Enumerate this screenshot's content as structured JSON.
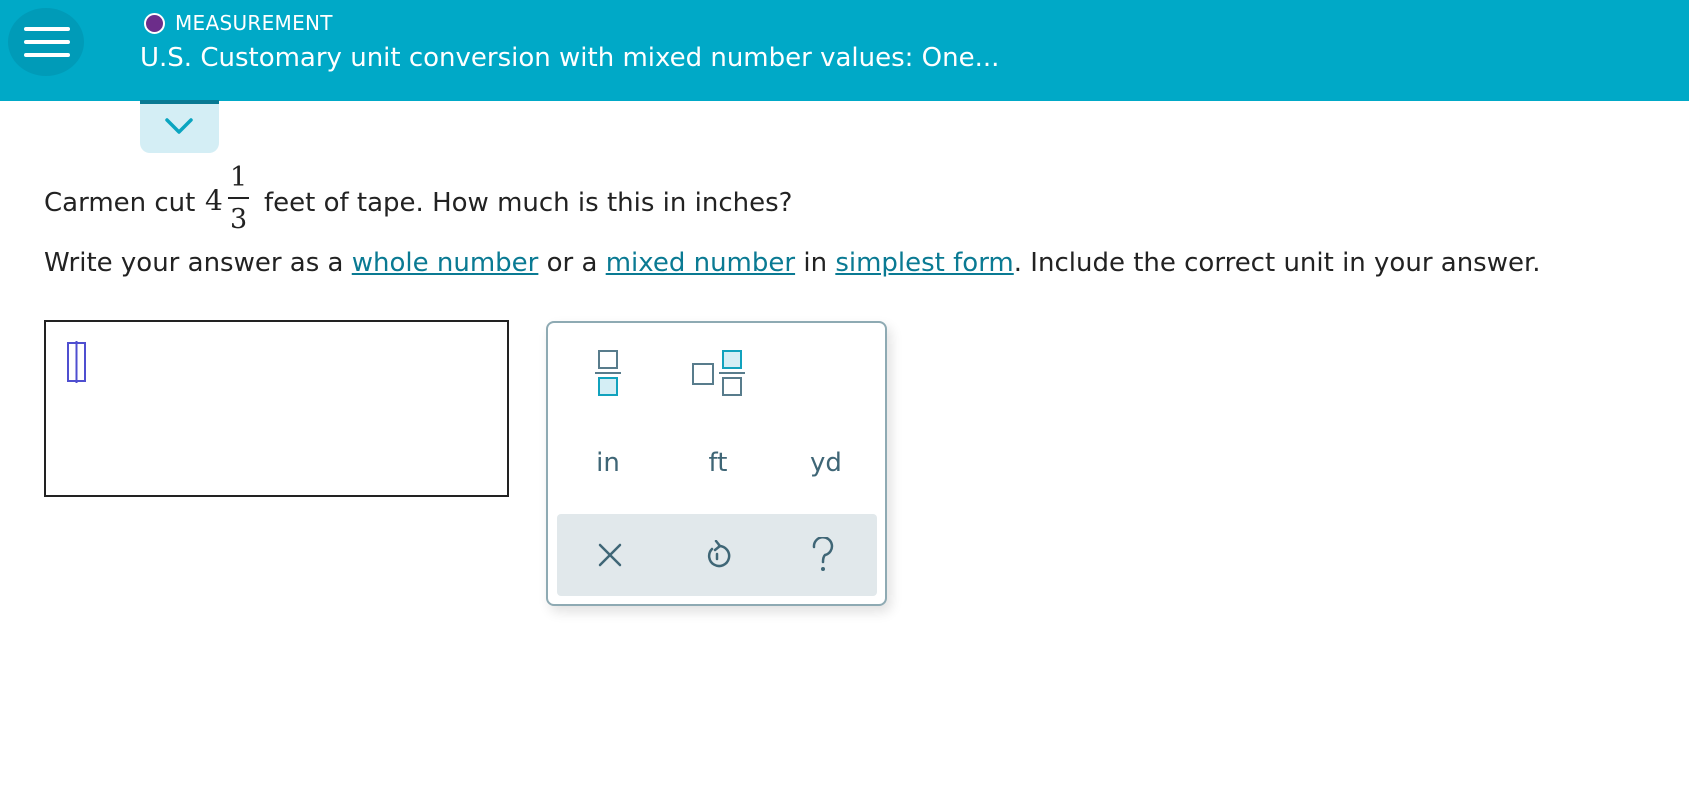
{
  "header": {
    "topic": "MEASUREMENT",
    "title": "U.S. Customary unit conversion with mixed number values: One...",
    "topic_dot_color": "#6c2d8a",
    "bar_color": "#00a9c7"
  },
  "question": {
    "before": "Carmen cut",
    "whole": "4",
    "numerator": "1",
    "denominator": "3",
    "after": "feet of tape. How much is this in inches?"
  },
  "instructions": {
    "part1": "Write your answer as a",
    "link1": "whole number",
    "part2": "or a",
    "link2": "mixed number",
    "part3": "in",
    "link3": "simplest form",
    "part4": ". Include the correct unit in your answer."
  },
  "answer": {
    "value": ""
  },
  "keypad": {
    "templates": [
      "fraction-template-icon",
      "mixed-number-template-icon"
    ],
    "units": [
      "in",
      "ft",
      "yd"
    ],
    "actions": [
      "clear-icon",
      "undo-icon",
      "help-icon"
    ]
  }
}
